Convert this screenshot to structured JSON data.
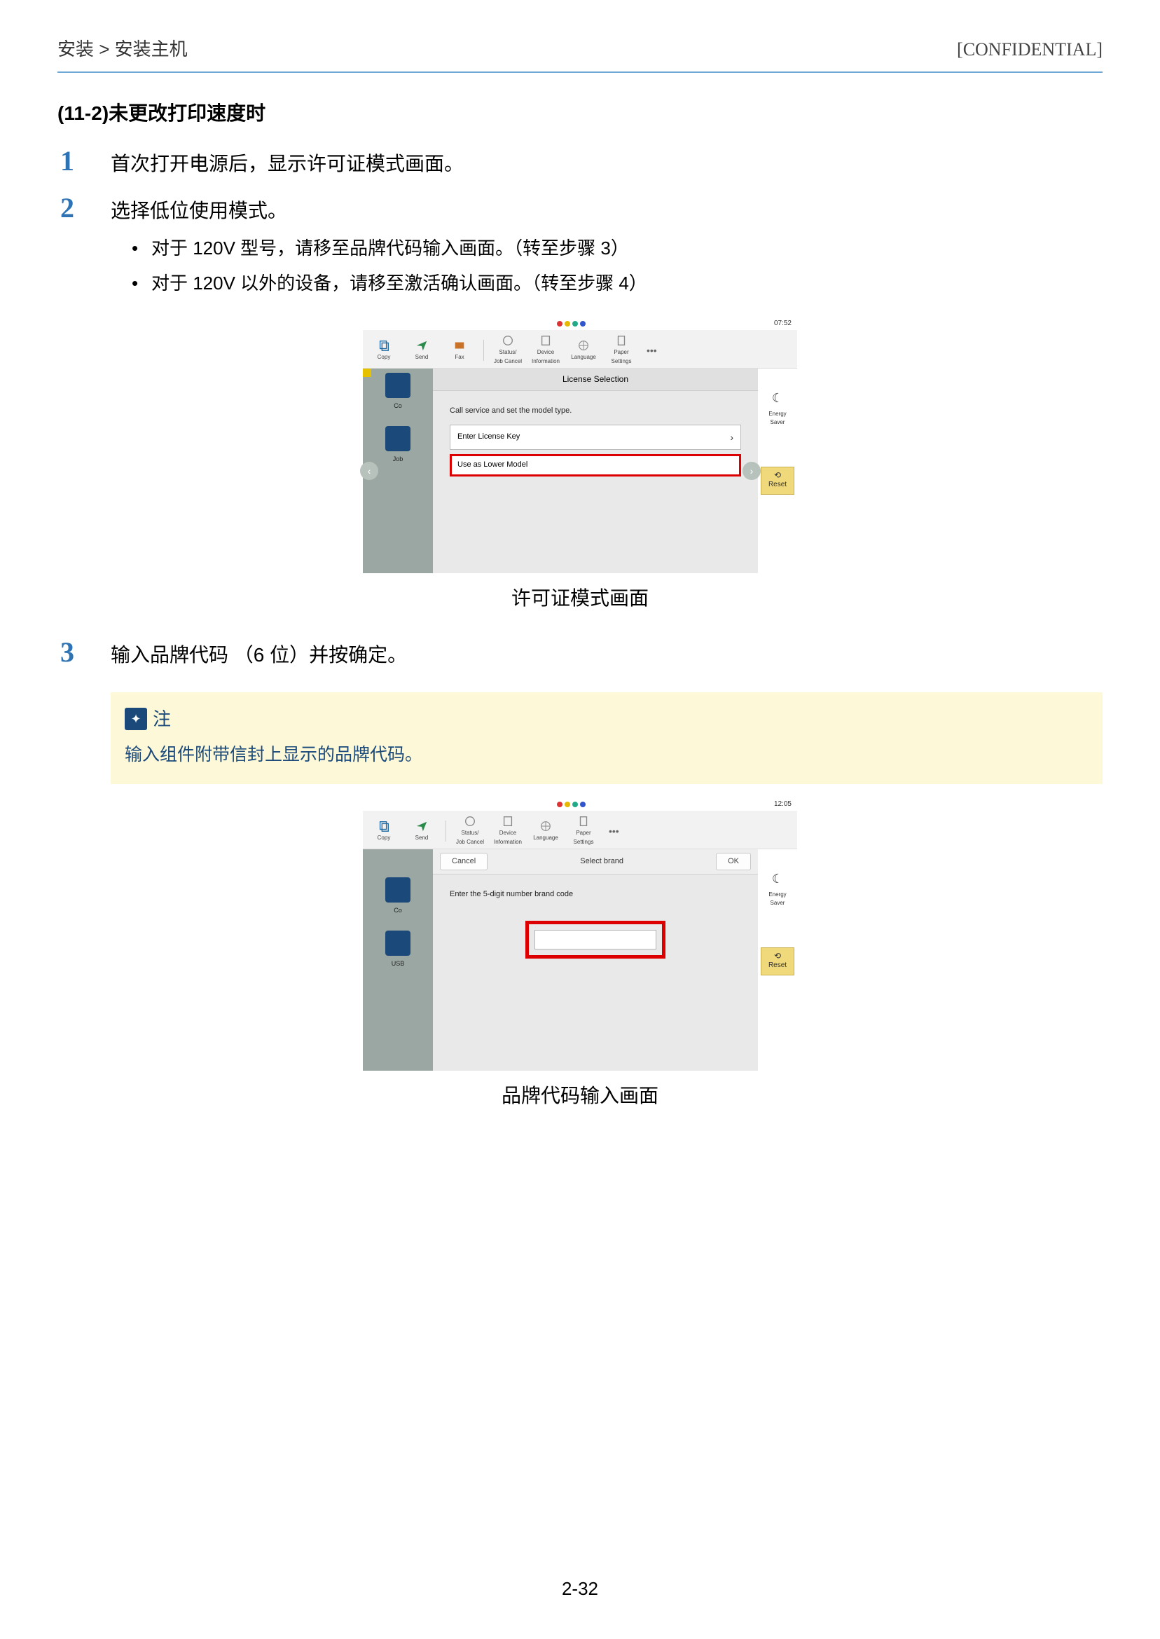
{
  "header": {
    "breadcrumb": "安装 > 安装主机",
    "confidential": "[CONFIDENTIAL]"
  },
  "section_title": "(11-2)未更改打印速度时",
  "steps": {
    "s1": {
      "num": "1",
      "text": "首次打开电源后，显示许可证模式画面。"
    },
    "s2": {
      "num": "2",
      "text": "选择低位使用模式。",
      "b1": "对于 120V 型号，请移至品牌代码输入画面。（转至步骤 3）",
      "b2": "对于 120V 以外的设备，请移至激活确认画面。（转至步骤 4）"
    },
    "s3": {
      "num": "3",
      "text": "输入品牌代码 （6 位）并按确定。"
    }
  },
  "fig1": {
    "time": "07:52",
    "tb": {
      "copy": "Copy",
      "send": "Send",
      "fax": "Fax",
      "status": "Status/\nJob Cancel",
      "device": "Device\nInformation",
      "language": "Language",
      "paper": "Paper Settings"
    },
    "title": "License Selection",
    "msg1": "Call service and set the model type.",
    "opt1": "Enter License Key",
    "opt2": "Use as Lower Model",
    "side": {
      "co": "Co",
      "job": "Job"
    },
    "energy": "Energy Saver",
    "reset": "Reset",
    "caption": "许可证模式画面"
  },
  "note": {
    "title": "注",
    "body": "输入组件附带信封上显示的品牌代码。"
  },
  "fig2": {
    "time": "12:05",
    "tb": {
      "copy": "Copy",
      "send": "Send",
      "status": "Status/\nJob Cancel",
      "device": "Device\nInformation",
      "language": "Language",
      "paper": "Paper Settings"
    },
    "cancel": "Cancel",
    "title": "Select brand",
    "ok": "OK",
    "prompt": "Enter the 5-digit number brand code",
    "side": {
      "co": "Co",
      "usb": "USB"
    },
    "energy": "Energy Saver",
    "reset": "Reset",
    "caption": "品牌代码输入画面"
  },
  "page_num": "2-32"
}
